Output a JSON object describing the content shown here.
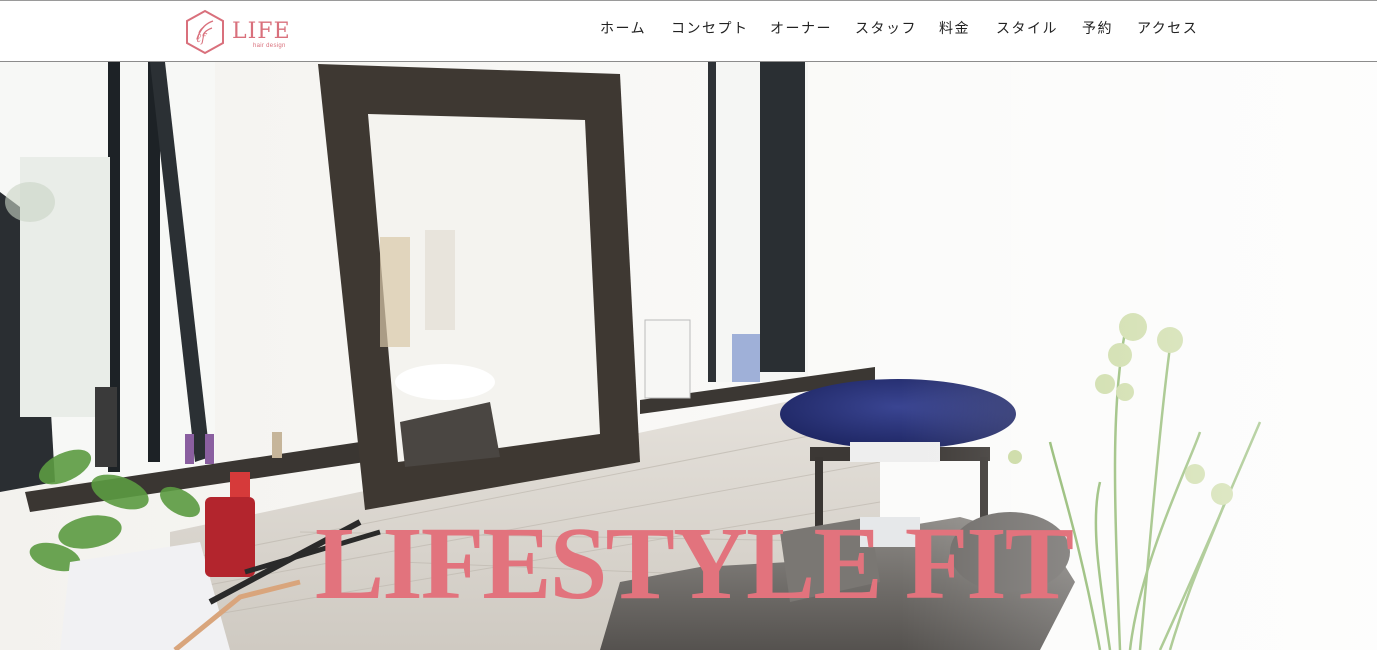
{
  "header": {
    "logo": {
      "text": "LIFE",
      "subtitle": "hair design",
      "brand_color": "#d9707c"
    },
    "nav": [
      {
        "label": "ホーム"
      },
      {
        "label": "コンセプト"
      },
      {
        "label": "オーナー"
      },
      {
        "label": "スタッフ"
      },
      {
        "label": "料金"
      },
      {
        "label": "スタイル"
      },
      {
        "label": "予約"
      },
      {
        "label": "アクセス"
      }
    ]
  },
  "hero": {
    "title": "LIFESTYLE FIT",
    "title_color": "#e2737d",
    "image_description_icon": "salon-interior-photo"
  }
}
